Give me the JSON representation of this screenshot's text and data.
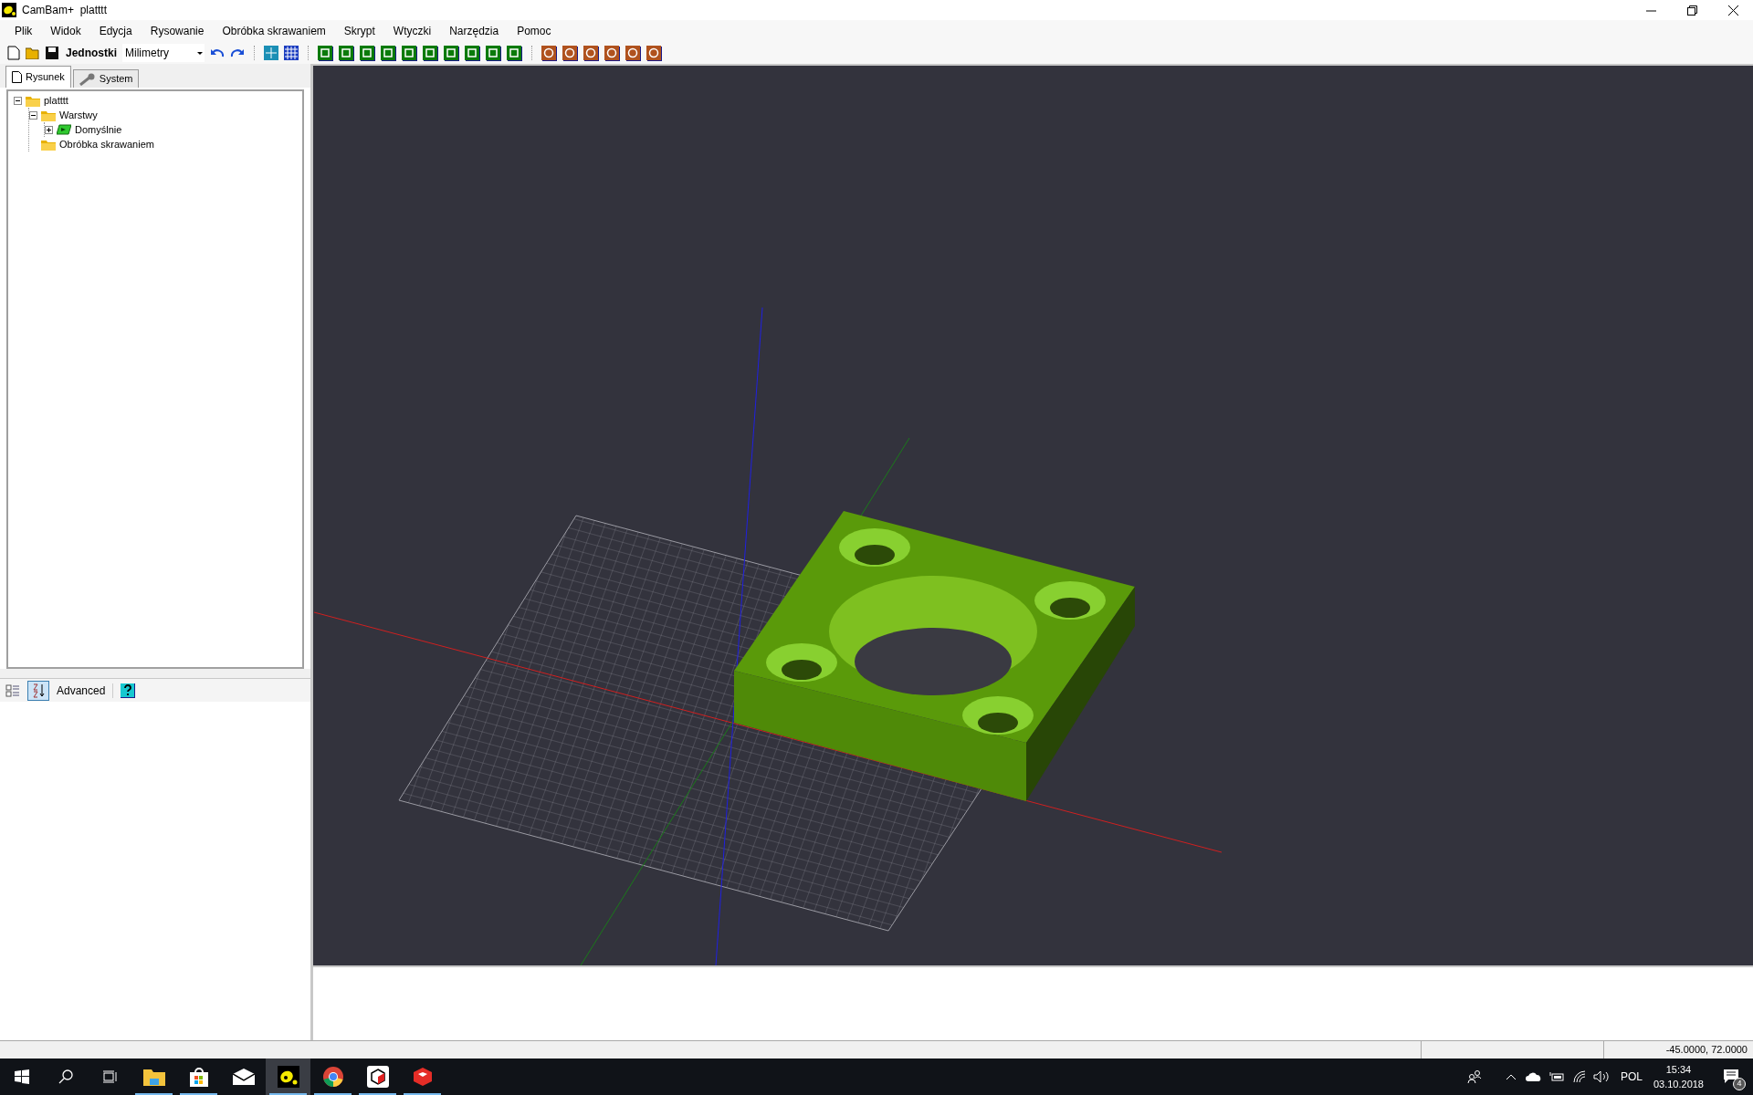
{
  "window": {
    "title": "CamBam+  platttt"
  },
  "menu": [
    "Plik",
    "Widok",
    "Edycja",
    "Rysowanie",
    "Obróbka skrawaniem",
    "Skrypt",
    "Wtyczki",
    "Narzędzia",
    "Pomoc"
  ],
  "toolbar": {
    "units_label": "Jednostki",
    "units_value": "Milimetry"
  },
  "tabs": [
    {
      "label": "Rysunek",
      "selected": true
    },
    {
      "label": "System",
      "selected": false
    }
  ],
  "tree": [
    {
      "label": "platttt",
      "kind": "folder",
      "expanded": true,
      "children": [
        {
          "label": "Warstwy",
          "kind": "folder",
          "expanded": true,
          "children": [
            {
              "label": "Domyślnie",
              "kind": "layer",
              "expanded": false
            }
          ]
        },
        {
          "label": "Obróbka skrawaniem",
          "kind": "folder"
        }
      ]
    }
  ],
  "property_toolbar": {
    "sorted_selected": true,
    "advanced": "Advanced"
  },
  "status_bar": {
    "coordinates": "-45.0000, 72.0000"
  },
  "taskbar": {
    "apps": [
      {
        "kind": "explorer",
        "running": true,
        "selected": false
      },
      {
        "kind": "store",
        "running": true,
        "selected": false
      },
      {
        "kind": "mail",
        "running": false,
        "selected": false
      },
      {
        "kind": "cambam",
        "running": true,
        "selected": true
      },
      {
        "kind": "chrome",
        "running": true,
        "selected": false
      },
      {
        "kind": "cube",
        "running": true,
        "selected": false
      },
      {
        "kind": "sketch",
        "running": true,
        "selected": false
      }
    ],
    "language": "POL",
    "time": "15:34",
    "date": "03.10.2018",
    "notifications": "4"
  }
}
